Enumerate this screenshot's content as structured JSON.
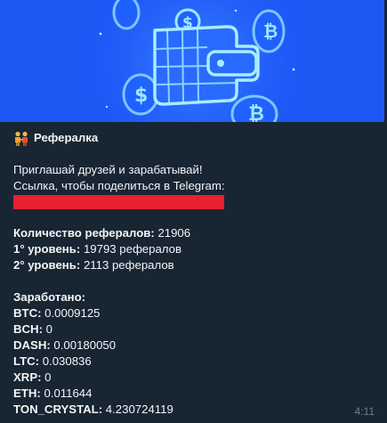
{
  "message": {
    "title": "Рефералка",
    "intro": "Приглашай друзей и зарабатывай!",
    "share_label": "Ссылка, чтобы поделиться в Telegram:",
    "referrals_label": "Количество рефералов:",
    "referrals_value": " 21906",
    "level1_label": "1° уровень:",
    "level1_value": " 19793 рефералов",
    "level2_label": "2° уровень:",
    "level2_value": " 2113 рефералов",
    "earned_label": "Заработано:",
    "earnings": [
      {
        "coin": "BTC:",
        "amount": " 0.0009125"
      },
      {
        "coin": "BCH:",
        "amount": " 0"
      },
      {
        "coin": "DASH:",
        "amount": " 0.00180050"
      },
      {
        "coin": "LTC:",
        "amount": " 0.030836"
      },
      {
        "coin": "XRP:",
        "amount": " 0"
      },
      {
        "coin": "ETH:",
        "amount": " 0.011644"
      },
      {
        "coin": "TON_CRYSTAL:",
        "amount": " 4.230724119"
      }
    ],
    "time": "4:11"
  },
  "colors": {
    "bubble": "#182533",
    "banner": "#1e5bff",
    "redaction": "#e8202f",
    "text": "#f5f5f5",
    "time": "#6d7f8f"
  }
}
